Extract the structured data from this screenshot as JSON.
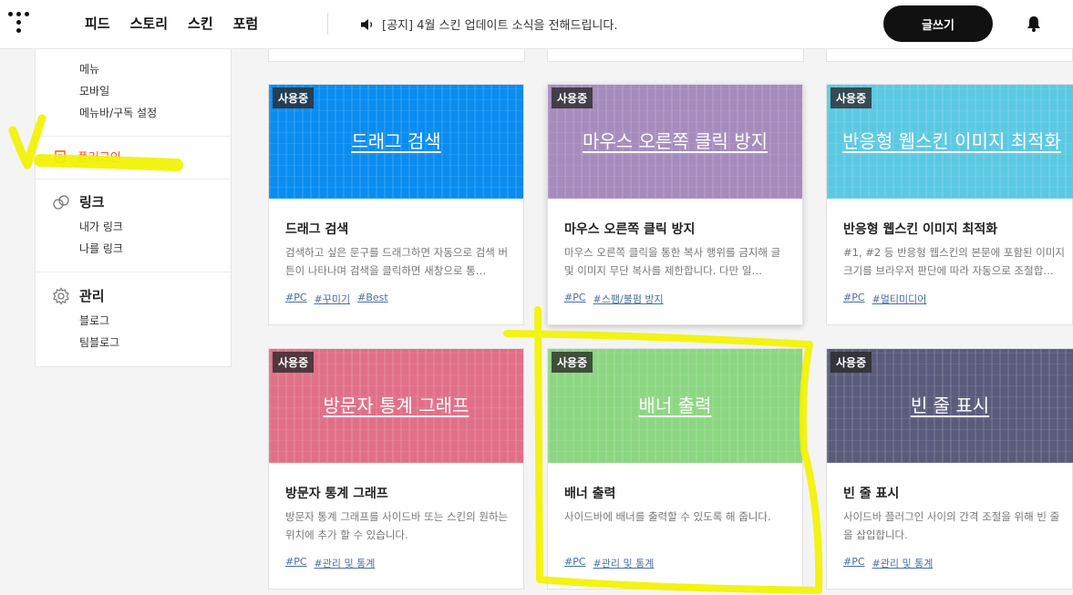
{
  "header": {
    "nav": [
      "피드",
      "스토리",
      "스킨",
      "포럼"
    ],
    "notice": "[공지] 4월 스킨 업데이트 소식을 전해드립니다.",
    "write_label": "글쓰기"
  },
  "sidebar": {
    "top_items": [
      "메뉴",
      "모바일",
      "메뉴바/구독 설정"
    ],
    "plugin_label": "플러그인",
    "link_group": {
      "label": "링크",
      "items": [
        "내가 링크",
        "나를 링크"
      ]
    },
    "manage_group": {
      "label": "관리",
      "items": [
        "블로그",
        "팀블로그"
      ]
    }
  },
  "cards": [
    {
      "badge": "사용중",
      "thumb_title": "드래그 검색",
      "title": "드래그 검색",
      "desc": "검색하고 싶은 문구를 드래그하면 자동으로 검색 버튼이 나타나며 검색을 클릭하면 새창으로 통…",
      "tags": [
        "#PC",
        "#꾸미기",
        "#Best"
      ],
      "color": "#0a8cf0"
    },
    {
      "badge": "사용중",
      "thumb_title": "마우스 오른쪽 클릭 방지",
      "title": "마우스 오른쪽 클릭 방지",
      "desc": "마우스 오른쪽 클릭을 통한 복사 행위를 금지해 글 및 이미지 무단 복사를 제한합니다. 다만 일…",
      "tags": [
        "#PC",
        "#스팸/불펌 방지"
      ],
      "color": "#a68bbd"
    },
    {
      "badge": "사용중",
      "thumb_title": "반응형 웹스킨 이미지 최적화",
      "title": "반응형 웹스킨 이미지 최적화",
      "desc": "#1, #2 등 반응형 웹스킨의 본문에 포함된 이미지 크기를 브라우저 판단에 따라 자동으로 조절합…",
      "tags": [
        "#PC",
        "#멀티미디어"
      ],
      "color": "#5cc9e3"
    },
    {
      "badge": "사용중",
      "thumb_title": "방문자 통계 그래프",
      "title": "방문자 통계 그래프",
      "desc": "방문자 통계 그래프를 사이드바 또는 스킨의 원하는 위치에 추가 할 수 있습니다.",
      "tags": [
        "#PC",
        "#관리 및 통계"
      ],
      "color": "#e07088"
    },
    {
      "badge": "사용중",
      "thumb_title": "배너 출력",
      "title": "배너 출력",
      "desc": "사이드바에 배너를 출력할 수 있도록 해 줍니다.",
      "tags": [
        "#PC",
        "#관리 및 통계"
      ],
      "color": "#8cd682"
    },
    {
      "badge": "사용중",
      "thumb_title": "빈 줄 표시",
      "title": "빈 줄 표시",
      "desc": "사이드바 플러그인 사이의 간격 조절을 위해 빈 줄을 삽입합니다.",
      "tags": [
        "#PC",
        "#관리 및 통계"
      ],
      "color": "#5a5c7c"
    }
  ],
  "highlight_color": "#f2f200"
}
